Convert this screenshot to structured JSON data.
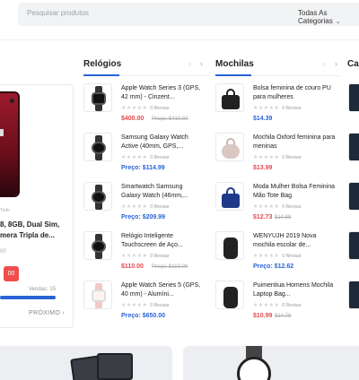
{
  "search": {
    "placeholder": "Pesquisar produtos",
    "category": "Todas As Categorias"
  },
  "featured": {
    "meta": "Todo",
    "name": "8, 8GB, Dual Sim, mera Tripla de...",
    "price_line": "00",
    "badge": "00",
    "sold": "Vendas: 15",
    "progress_percent": 100,
    "next": "PRÓXIMO"
  },
  "columns": [
    {
      "title": "Relógios",
      "items": [
        {
          "name": "Apple Watch Series 3 (GPS, 42 mm) - Cinzent...",
          "reviews": "0 Revisar",
          "price": "$400.00",
          "old": "Preço: $410.00",
          "price_color": "red",
          "icon": "black-watch-icon"
        },
        {
          "name": "Samsung Galaxy Watch Active (40mm, GPS,...",
          "reviews": "0 Revisar",
          "price": "Preço: $114.99",
          "old": "",
          "price_color": "blue",
          "icon": "round-watch-icon"
        },
        {
          "name": "Smartwatch Samsung Galaxy Watch (46mm,...",
          "reviews": "0 Revisar",
          "price": "Preço: $209.99",
          "old": "",
          "price_color": "blue",
          "icon": "smartwatch-icon"
        },
        {
          "name": "Relógio Inteligente Touchscreen de Aço...",
          "reviews": "0 Revisar",
          "price": "$110.00",
          "old": "Preço: $119.00",
          "price_color": "red",
          "icon": "steel-watch-icon"
        },
        {
          "name": "Apple Watch Series 5 (GPS, 40 mm) - Alumíni...",
          "reviews": "0 Revisar",
          "price": "Preço: $650.00",
          "old": "",
          "price_color": "blue",
          "icon": "pink-watch-icon"
        }
      ]
    },
    {
      "title": "Mochilas",
      "items": [
        {
          "name": "Bolsa feminina de couro PU para mulheres",
          "reviews": "0 Revisar",
          "price": "$14.39",
          "old": "",
          "price_color": "blue",
          "icon": "black-handbag-icon"
        },
        {
          "name": "Mochila Oxford feminina para meninas",
          "reviews": "0 Revisar",
          "price": "$13.99",
          "old": "",
          "price_color": "red",
          "icon": "pink-backpack-icon"
        },
        {
          "name": "Moda Mulher Bolsa Feminina Mão Tote Bag",
          "reviews": "0 Revisar",
          "price": "$12.73",
          "old": "$14.99",
          "price_color": "red",
          "icon": "navy-tote-icon"
        },
        {
          "name": "WENYUJH 2019 Nova mochila escolar de...",
          "reviews": "0 Revisar",
          "price": "Preço: $12.62",
          "old": "",
          "price_color": "blue",
          "icon": "school-backpack-icon"
        },
        {
          "name": "Puimentiua Homens Mochila Laptop Bag...",
          "reviews": "0 Revisar",
          "price": "$10.99",
          "old": "$14.79",
          "price_color": "red",
          "icon": "laptop-backpack-icon"
        }
      ]
    }
  ],
  "clipped_column_title": "Ca",
  "colors": {
    "accent": "#2a63d6",
    "sale": "#e5484d"
  }
}
